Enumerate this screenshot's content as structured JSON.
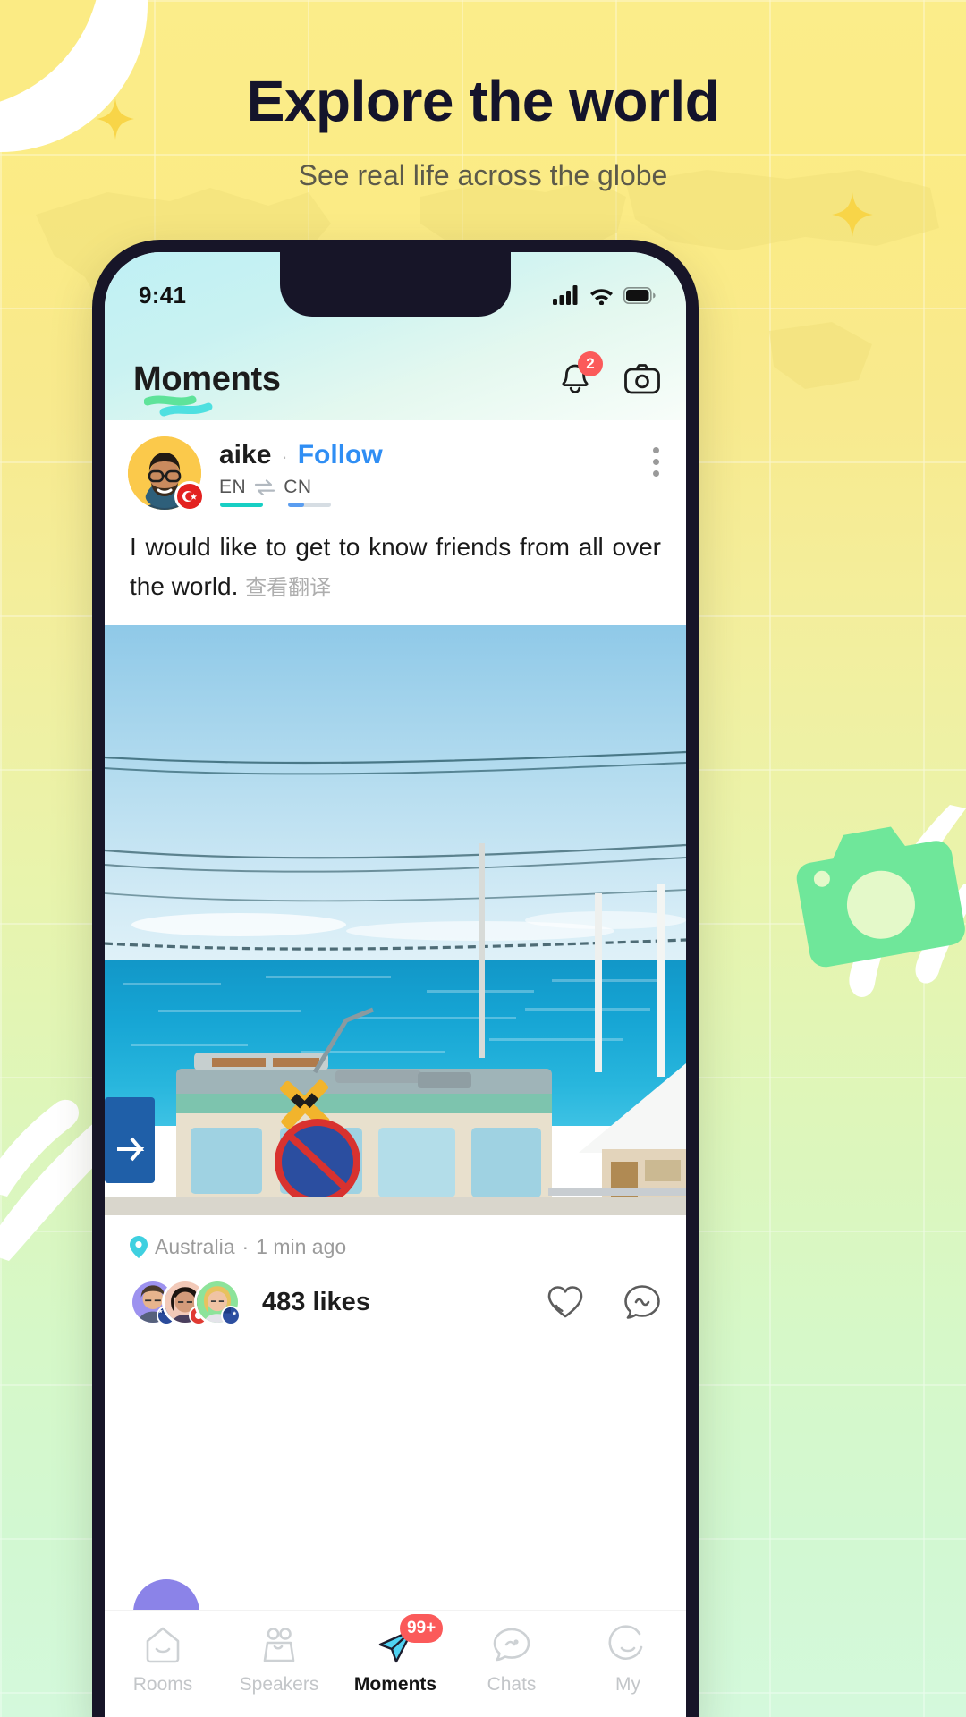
{
  "hero": {
    "headline": "Explore the world",
    "subheadline": "See real life across the globe"
  },
  "colors": {
    "bg_top": "#fbed8a",
    "bg_bottom": "#d4f9dc",
    "accent_blue": "#2f8ef4",
    "accent_teal": "#17cfc4",
    "badge_red": "#fb5a5a",
    "sparkle_gold": "#f8d548",
    "deco_green": "#6fe79a"
  },
  "phone": {
    "status_bar": {
      "time": "9:41",
      "signal_icon": "cellular-signal-icon",
      "wifi_icon": "wifi-icon",
      "battery_icon": "battery-full-icon"
    },
    "app_header": {
      "title": "Moments",
      "notifications_icon": "bell-icon",
      "notifications_badge": "2",
      "camera_icon": "camera-icon"
    },
    "post": {
      "author": "aike",
      "separator": "·",
      "follow_label": "Follow",
      "avatar_icon": "user-avatar",
      "flag_icon": "turkey-flag-icon",
      "language_from": "EN",
      "language_swap_icon": "swap-arrows-icon",
      "language_to": "CN",
      "menu_icon": "more-options-icon",
      "body": "I would like to get to know friends from all over the world.",
      "translate_label": "查看翻译",
      "photo_alt": "coastal-tram-photo",
      "location_icon": "location-pin-icon",
      "location": "Australia",
      "time_separator": "·",
      "time_ago": "1 min ago",
      "likes": "483 likes",
      "like_icon": "heart-icon",
      "comment_icon": "comment-icon"
    },
    "tabbar": {
      "items": [
        {
          "label": "Rooms",
          "icon": "rooms-icon",
          "active": false,
          "badge": ""
        },
        {
          "label": "Speakers",
          "icon": "speakers-icon",
          "active": false,
          "badge": ""
        },
        {
          "label": "Moments",
          "icon": "paper-plane-icon",
          "active": true,
          "badge": "99+"
        },
        {
          "label": "Chats",
          "icon": "chat-bubble-icon",
          "active": false,
          "badge": ""
        },
        {
          "label": "My",
          "icon": "profile-icon",
          "active": false,
          "badge": ""
        }
      ]
    }
  }
}
